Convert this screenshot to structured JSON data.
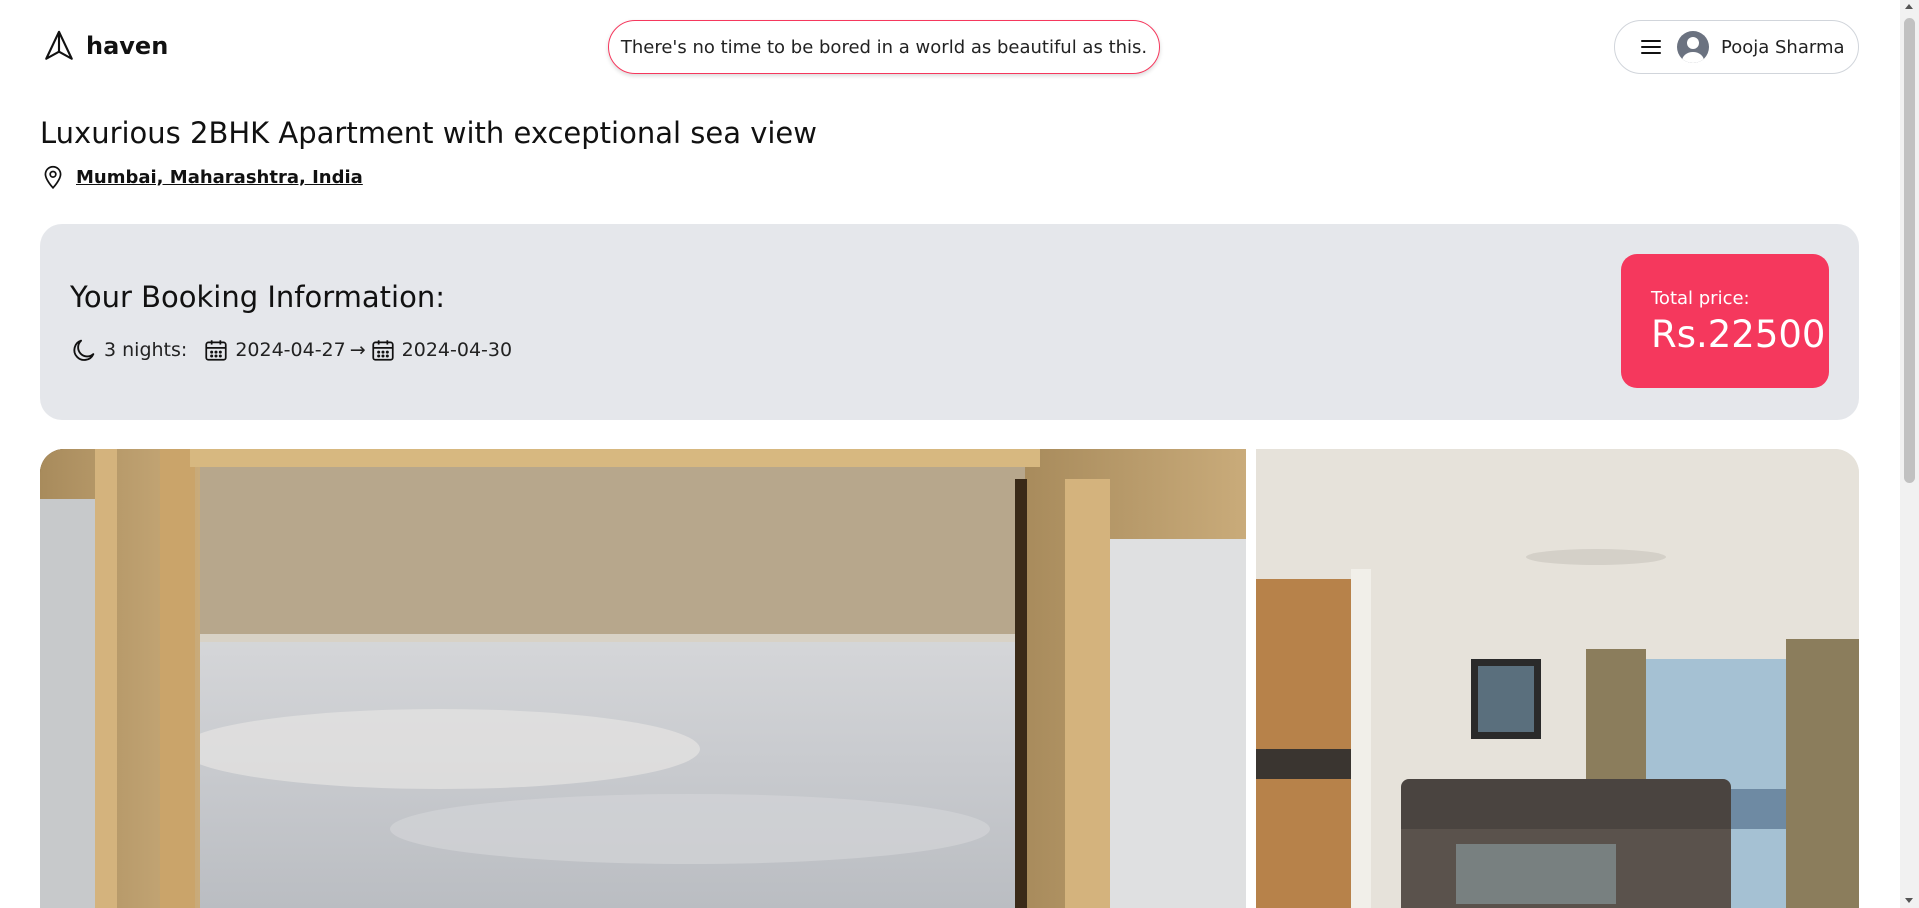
{
  "header": {
    "logo_text": "haven",
    "tagline": "There's no time to be bored in a world as beautiful as this.",
    "user_name": "Pooja Sharma",
    "icons": [
      "paper-plane-icon",
      "menu-icon",
      "avatar-icon"
    ]
  },
  "listing": {
    "title": "Luxurious 2BHK Apartment with exceptional sea view",
    "location": "Mumbai, Maharashtra, India"
  },
  "booking": {
    "heading": "Your Booking Information:",
    "nights": "3 nights:",
    "check_in": "2024-04-27",
    "arrow": "→",
    "check_out": "2024-04-30",
    "price_label": "Total price:",
    "price_value": "Rs.22500"
  },
  "colors": {
    "accent": "#f5385d",
    "booking_bg": "#e5e7eb"
  }
}
